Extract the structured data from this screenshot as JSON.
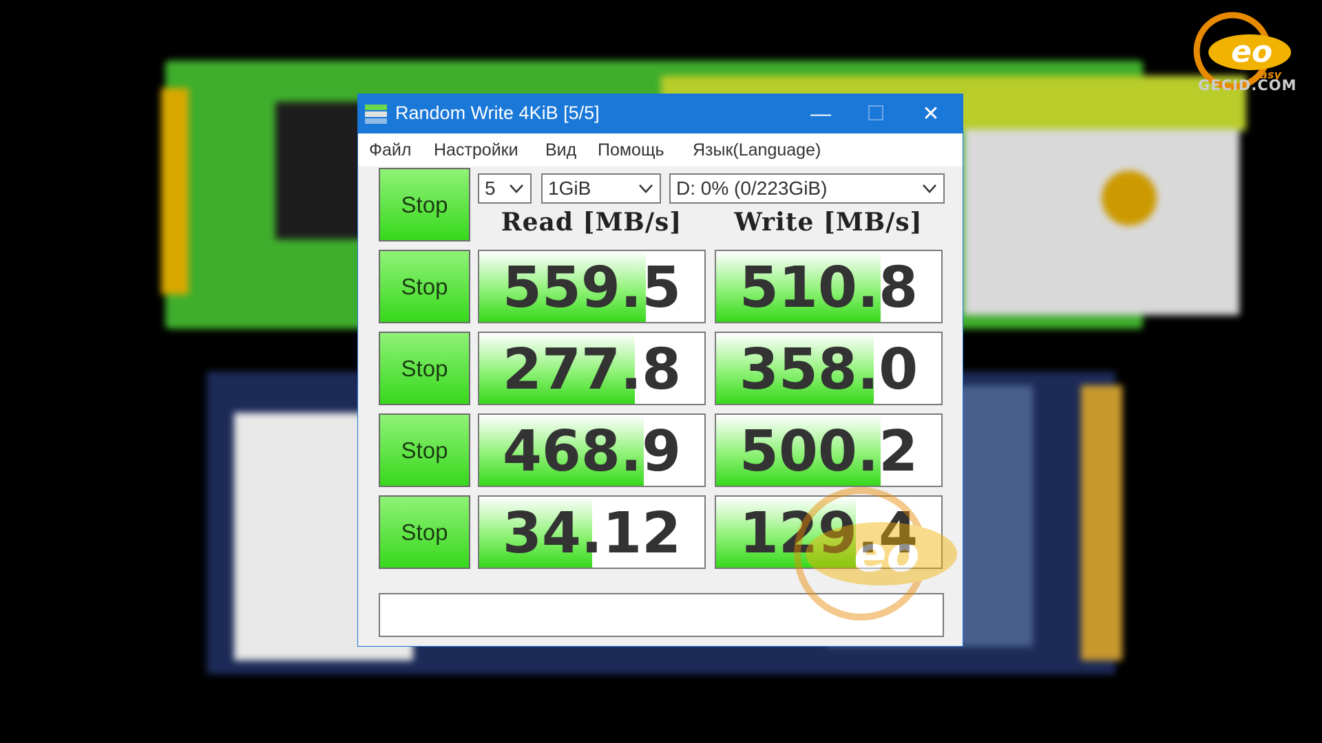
{
  "window": {
    "title": "Random Write 4KiB [5/5]",
    "controls": {
      "minimize": "—",
      "maximize": "☐",
      "close": "✕"
    }
  },
  "menu": [
    "Файл",
    "Настройки",
    "Вид",
    "Помощь",
    "Язык(Language)"
  ],
  "settings": {
    "count": "5",
    "size": "1GiB",
    "drive": "D: 0% (0/223GiB)"
  },
  "headers": {
    "read": "Read [MB/s]",
    "write": "Write [MB/s]"
  },
  "buttons": {
    "all": "Stop",
    "rows": [
      "Stop",
      "Stop",
      "Stop",
      "Stop"
    ]
  },
  "results": [
    {
      "read": "559.5",
      "write": "510.8",
      "read_level": 0.74,
      "write_level": 0.73
    },
    {
      "read": "277.8",
      "write": "358.0",
      "read_level": 0.69,
      "write_level": 0.7
    },
    {
      "read": "468.9",
      "write": "500.2",
      "read_level": 0.73,
      "write_level": 0.73
    },
    {
      "read": "34.12",
      "write": "129.4",
      "read_level": 0.5,
      "write_level": 0.62
    }
  ],
  "comment": "",
  "logo": {
    "text": "GECID.COM"
  },
  "colors": {
    "titlebar": "#1a78d8",
    "bar_green": "#37d81c"
  }
}
